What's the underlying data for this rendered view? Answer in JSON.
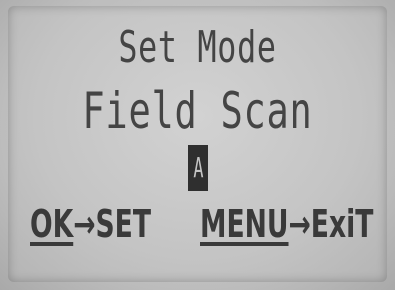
{
  "screen": {
    "mode_title": "Set Mode",
    "current_value": "Field Scan",
    "cursor_char": "A"
  },
  "softkeys": {
    "ok_key": "OK",
    "ok_action": "→SET",
    "menu_key": "MENU",
    "menu_action": "→ExiT"
  }
}
